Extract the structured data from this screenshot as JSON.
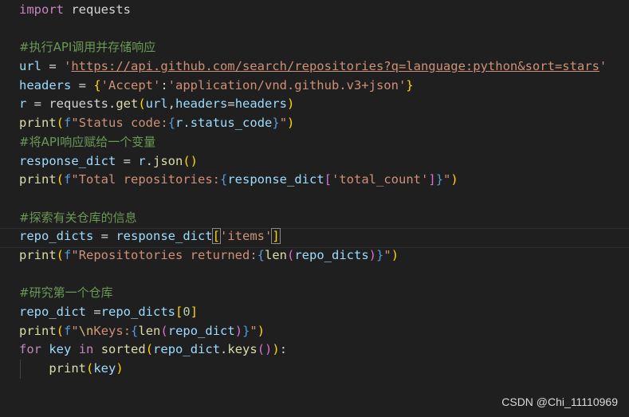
{
  "editor": {
    "lines": [
      [
        {
          "t": "import",
          "c": "kw"
        },
        {
          "t": " requests",
          "c": "op"
        }
      ],
      [],
      [
        {
          "t": "#执行API调用并存储响应",
          "c": "cmt"
        }
      ],
      [
        {
          "t": "url",
          "c": "var"
        },
        {
          "t": " = ",
          "c": "op"
        },
        {
          "t": "'",
          "c": "str"
        },
        {
          "t": "https://api.github.com/search/repositories?q=language:python&sort=stars",
          "c": "url"
        },
        {
          "t": "'",
          "c": "str"
        }
      ],
      [
        {
          "t": "headers",
          "c": "var"
        },
        {
          "t": " = ",
          "c": "op"
        },
        {
          "t": "{",
          "c": "br1"
        },
        {
          "t": "'Accept'",
          "c": "str"
        },
        {
          "t": ":",
          "c": "op"
        },
        {
          "t": "'application/vnd.github.v3+json'",
          "c": "str"
        },
        {
          "t": "}",
          "c": "br1"
        }
      ],
      [
        {
          "t": "r",
          "c": "var"
        },
        {
          "t": " = requests.",
          "c": "op"
        },
        {
          "t": "get",
          "c": "fn"
        },
        {
          "t": "(",
          "c": "br1"
        },
        {
          "t": "url",
          "c": "var"
        },
        {
          "t": ",",
          "c": "op"
        },
        {
          "t": "headers",
          "c": "var"
        },
        {
          "t": "=",
          "c": "op"
        },
        {
          "t": "headers",
          "c": "var"
        },
        {
          "t": ")",
          "c": "br1"
        }
      ],
      [
        {
          "t": "print",
          "c": "fn"
        },
        {
          "t": "(",
          "c": "br1"
        },
        {
          "t": "f",
          "c": "fpre"
        },
        {
          "t": "\"Status code:",
          "c": "str"
        },
        {
          "t": "{",
          "c": "kw2"
        },
        {
          "t": "r",
          "c": "var"
        },
        {
          "t": ".status_code",
          "c": "var"
        },
        {
          "t": "}",
          "c": "kw2"
        },
        {
          "t": "\"",
          "c": "str"
        },
        {
          "t": ")",
          "c": "br1"
        }
      ],
      [
        {
          "t": "#将API响应赋给一个变量",
          "c": "cmt"
        }
      ],
      [
        {
          "t": "response_dict",
          "c": "var"
        },
        {
          "t": " = ",
          "c": "op"
        },
        {
          "t": "r",
          "c": "var"
        },
        {
          "t": ".",
          "c": "op"
        },
        {
          "t": "json",
          "c": "fn"
        },
        {
          "t": "()",
          "c": "br1"
        }
      ],
      [
        {
          "t": "print",
          "c": "fn"
        },
        {
          "t": "(",
          "c": "br1"
        },
        {
          "t": "f",
          "c": "fpre"
        },
        {
          "t": "\"Total repositories:",
          "c": "str"
        },
        {
          "t": "{",
          "c": "kw2"
        },
        {
          "t": "response_dict",
          "c": "var"
        },
        {
          "t": "[",
          "c": "br2"
        },
        {
          "t": "'total_count'",
          "c": "str"
        },
        {
          "t": "]",
          "c": "br2"
        },
        {
          "t": "}",
          "c": "kw2"
        },
        {
          "t": "\"",
          "c": "str"
        },
        {
          "t": ")",
          "c": "br1"
        }
      ],
      [],
      [
        {
          "t": "#探索有关仓库的信息",
          "c": "cmt"
        }
      ],
      [
        {
          "t": "repo_dicts",
          "c": "var"
        },
        {
          "t": " = ",
          "c": "op"
        },
        {
          "t": "response_dict",
          "c": "var"
        },
        {
          "t": "[",
          "c": "br1 bracket-match"
        },
        {
          "t": "'items'",
          "c": "str"
        },
        {
          "t": "]",
          "c": "br1 bracket-match"
        }
      ],
      [
        {
          "t": "print",
          "c": "fn"
        },
        {
          "t": "(",
          "c": "br1"
        },
        {
          "t": "f",
          "c": "fpre"
        },
        {
          "t": "\"Repositotories returned:",
          "c": "str"
        },
        {
          "t": "{",
          "c": "kw2"
        },
        {
          "t": "len",
          "c": "fn"
        },
        {
          "t": "(",
          "c": "br2"
        },
        {
          "t": "repo_dicts",
          "c": "var"
        },
        {
          "t": ")",
          "c": "br2"
        },
        {
          "t": "}",
          "c": "kw2"
        },
        {
          "t": "\"",
          "c": "str"
        },
        {
          "t": ")",
          "c": "br1"
        }
      ],
      [],
      [
        {
          "t": "#研究第一个仓库",
          "c": "cmt"
        }
      ],
      [
        {
          "t": "repo_dict",
          "c": "var"
        },
        {
          "t": " =",
          "c": "op"
        },
        {
          "t": "repo_dicts",
          "c": "var"
        },
        {
          "t": "[",
          "c": "br1"
        },
        {
          "t": "0",
          "c": "num"
        },
        {
          "t": "]",
          "c": "br1"
        }
      ],
      [
        {
          "t": "print",
          "c": "fn"
        },
        {
          "t": "(",
          "c": "br1"
        },
        {
          "t": "f",
          "c": "fpre"
        },
        {
          "t": "\"",
          "c": "str"
        },
        {
          "t": "\\n",
          "c": "esc"
        },
        {
          "t": "Keys:",
          "c": "str"
        },
        {
          "t": "{",
          "c": "kw2"
        },
        {
          "t": "len",
          "c": "fn"
        },
        {
          "t": "(",
          "c": "br2"
        },
        {
          "t": "repo_dict",
          "c": "var"
        },
        {
          "t": ")",
          "c": "br2"
        },
        {
          "t": "}",
          "c": "kw2"
        },
        {
          "t": "\"",
          "c": "str"
        },
        {
          "t": ")",
          "c": "br1"
        }
      ],
      [
        {
          "t": "for",
          "c": "kw"
        },
        {
          "t": " ",
          "c": "op"
        },
        {
          "t": "key",
          "c": "var"
        },
        {
          "t": " ",
          "c": "op"
        },
        {
          "t": "in",
          "c": "kw"
        },
        {
          "t": " ",
          "c": "op"
        },
        {
          "t": "sorted",
          "c": "fn"
        },
        {
          "t": "(",
          "c": "br1"
        },
        {
          "t": "repo_dict",
          "c": "var"
        },
        {
          "t": ".",
          "c": "op"
        },
        {
          "t": "keys",
          "c": "fn"
        },
        {
          "t": "()",
          "c": "br2"
        },
        {
          "t": ")",
          "c": "br1"
        },
        {
          "t": ":",
          "c": "op"
        }
      ],
      [
        {
          "t": "    ",
          "c": "op"
        },
        {
          "t": "print",
          "c": "fn"
        },
        {
          "t": "(",
          "c": "br1"
        },
        {
          "t": "key",
          "c": "var"
        },
        {
          "t": ")",
          "c": "br1"
        }
      ]
    ]
  },
  "watermark": "CSDN @Chi_11110969"
}
